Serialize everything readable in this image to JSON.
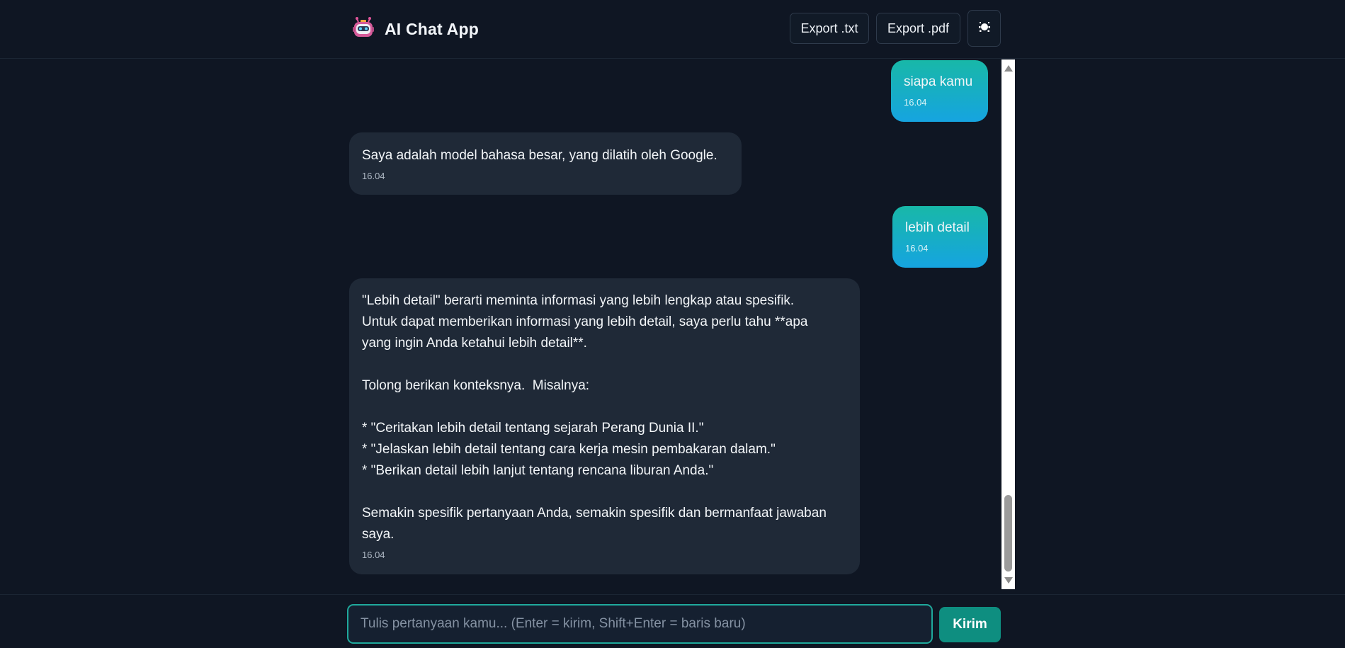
{
  "header": {
    "title": "AI Chat App",
    "logo_icon": "robot-icon",
    "export_txt_label": "Export .txt",
    "export_pdf_label": "Export .pdf",
    "theme_icon": "theme-toggle-icon"
  },
  "messages": [
    {
      "role": "user",
      "text": "siapa kamu",
      "time": "16.04"
    },
    {
      "role": "assistant",
      "text": "Saya adalah model bahasa besar, yang dilatih oleh Google.",
      "time": "16.04"
    },
    {
      "role": "user",
      "text": "lebih detail",
      "time": "16.04"
    },
    {
      "role": "assistant",
      "text": "\"Lebih detail\" berarti meminta informasi yang lebih lengkap atau spesifik.\nUntuk dapat memberikan informasi yang lebih detail, saya perlu tahu **apa\nyang ingin Anda ketahui lebih detail**.\n\nTolong berikan konteksnya.  Misalnya:\n\n* \"Ceritakan lebih detail tentang sejarah Perang Dunia II.\"\n* \"Jelaskan lebih detail tentang cara kerja mesin pembakaran dalam.\"\n* \"Berikan detail lebih lanjut tentang rencana liburan Anda.\"\n\nSemakin spesifik pertanyaan Anda, semakin spesifik dan bermanfaat jawaban\nsaya.",
      "time": "16.04"
    }
  ],
  "composer": {
    "placeholder": "Tulis pertanyaan kamu... (Enter = kirim, Shift+Enter = baris baru)",
    "value": "",
    "send_label": "Kirim"
  },
  "colors": {
    "background": "#0f1623",
    "assistant_bubble": "#1f2937",
    "user_bubble_top": "#18b8a8",
    "user_bubble_bottom": "#16a4e0",
    "accent": "#1fa99c",
    "send_button": "#0e8e80"
  }
}
